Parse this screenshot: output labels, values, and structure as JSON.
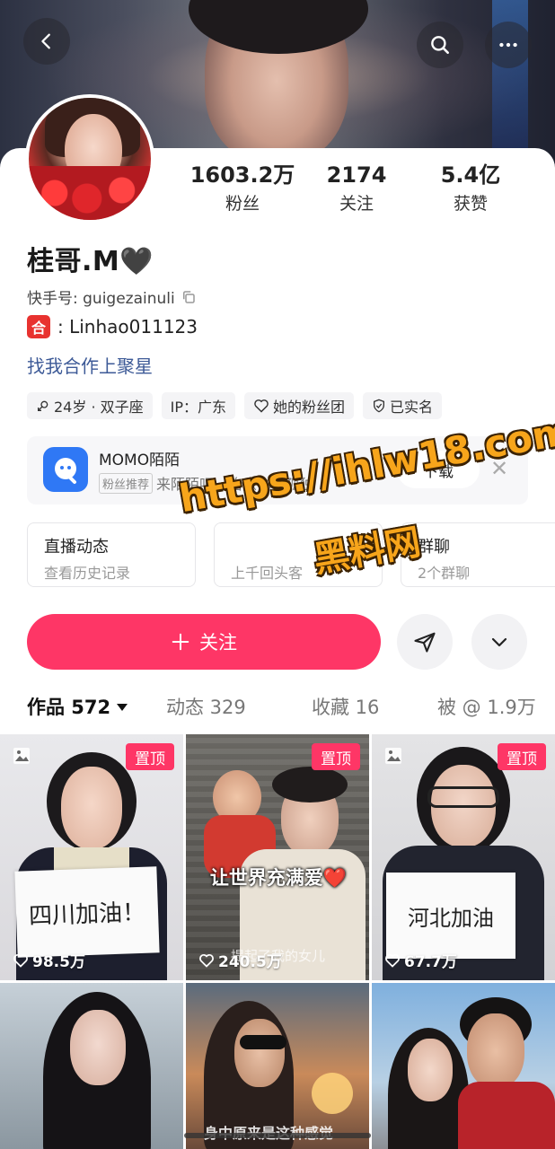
{
  "profile": {
    "name": "桂哥.M🖤",
    "kuaishou_id": "快手号: guigezainuli",
    "coop_badge": "合",
    "coop_text": ": Linhao011123",
    "juxing_link": "找我合作上聚星"
  },
  "stats": [
    {
      "num": "1603.2万",
      "label": "粉丝"
    },
    {
      "num": "2174",
      "label": "关注"
    },
    {
      "num": "5.4亿",
      "label": "获赞"
    }
  ],
  "tags": [
    "24岁 · 双子座",
    "IP：广东",
    "她的粉丝团",
    "已实名"
  ],
  "ad": {
    "title": "MOMO陌陌",
    "badge": "粉丝推荐",
    "desc": "来陌陌吧，治愈你的孤独",
    "download": "下载",
    "close": "✕"
  },
  "entries": [
    {
      "title": "直播动态",
      "sub": "查看历史记录"
    },
    {
      "title": "",
      "sub": "上千回头客"
    },
    {
      "title": "群聊",
      "sub": "2个群聊"
    }
  ],
  "watermark": {
    "line1": "https://ihlw18.com",
    "line2": "黑料网"
  },
  "actions": {
    "follow": "关注"
  },
  "tabs": [
    {
      "label": "作品 572"
    },
    {
      "label": "动态 329"
    },
    {
      "label": "收藏 16"
    },
    {
      "label": "被 @ 1.9万"
    }
  ],
  "grid": [
    {
      "pinned": "置顶",
      "likes": "98.5万",
      "sign": "四川加油！"
    },
    {
      "pinned": "置顶",
      "likes": "240.5万",
      "caption": "让世界充满爱❤️",
      "subcaption": "提起了我的女儿"
    },
    {
      "pinned": "置顶",
      "likes": "67.7万",
      "sign": "河北加油"
    },
    {},
    {
      "caption": "身中原来是这种感觉"
    },
    {}
  ]
}
